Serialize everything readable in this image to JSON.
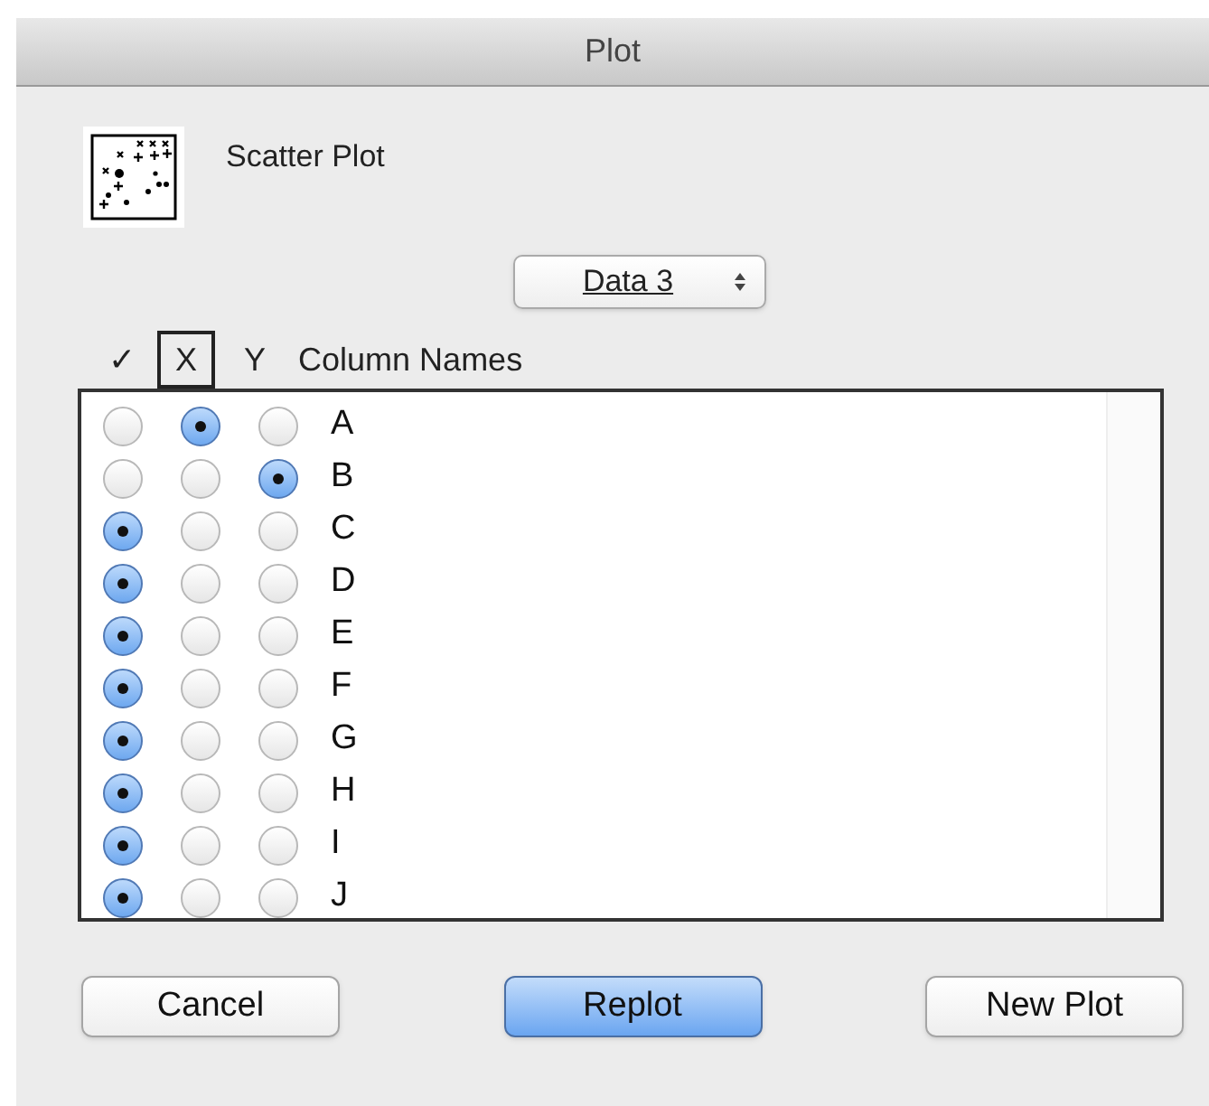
{
  "window": {
    "title": "Plot"
  },
  "plot_type": {
    "label": "Scatter Plot"
  },
  "data_select": {
    "value": "Data 3"
  },
  "headers": [
    {
      "label": "✓",
      "selected": false
    },
    {
      "label": "X",
      "selected": true
    },
    {
      "label": "Y",
      "selected": false
    },
    {
      "label": "Column Names",
      "selected": false
    }
  ],
  "rows": [
    {
      "name": "A",
      "radios": [
        {
          "selected": false
        },
        {
          "selected": true
        },
        {
          "selected": false
        }
      ]
    },
    {
      "name": "B",
      "radios": [
        {
          "selected": false
        },
        {
          "selected": false
        },
        {
          "selected": true
        }
      ]
    },
    {
      "name": "C",
      "radios": [
        {
          "selected": true
        },
        {
          "selected": false
        },
        {
          "selected": false
        }
      ]
    },
    {
      "name": "D",
      "radios": [
        {
          "selected": true
        },
        {
          "selected": false
        },
        {
          "selected": false
        }
      ]
    },
    {
      "name": "E",
      "radios": [
        {
          "selected": true
        },
        {
          "selected": false
        },
        {
          "selected": false
        }
      ]
    },
    {
      "name": "F",
      "radios": [
        {
          "selected": true
        },
        {
          "selected": false
        },
        {
          "selected": false
        }
      ]
    },
    {
      "name": "G",
      "radios": [
        {
          "selected": true
        },
        {
          "selected": false
        },
        {
          "selected": false
        }
      ]
    },
    {
      "name": "H",
      "radios": [
        {
          "selected": true
        },
        {
          "selected": false
        },
        {
          "selected": false
        }
      ]
    },
    {
      "name": "I",
      "radios": [
        {
          "selected": true
        },
        {
          "selected": false
        },
        {
          "selected": false
        }
      ]
    },
    {
      "name": "J",
      "radios": [
        {
          "selected": true
        },
        {
          "selected": false
        },
        {
          "selected": false
        }
      ]
    }
  ],
  "buttons": [
    {
      "label": "Cancel",
      "default": false
    },
    {
      "label": "Replot",
      "default": true
    },
    {
      "label": "New Plot",
      "default": false
    }
  ]
}
